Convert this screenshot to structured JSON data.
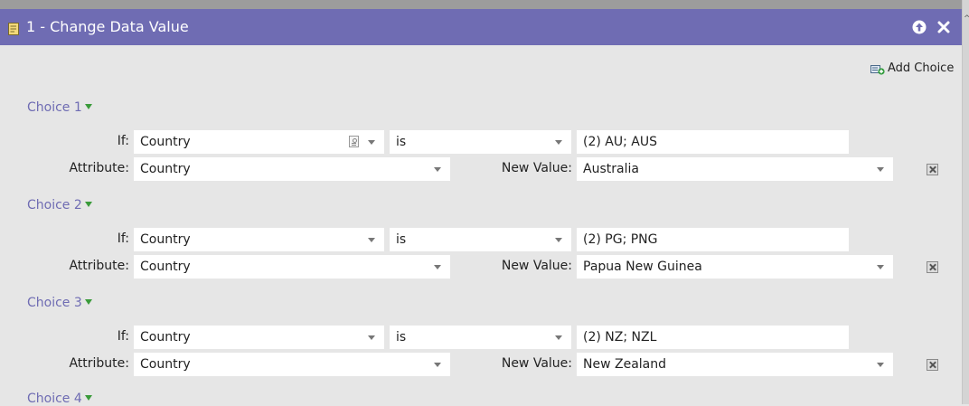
{
  "dialog": {
    "title": "1 - Change Data Value",
    "icon": "document-edit-icon",
    "controls": [
      "arrow-up-icon",
      "close-icon"
    ]
  },
  "toolbar": {
    "add_choice_label": "Add Choice",
    "add_choice_icon": "add-choice-icon"
  },
  "labels": {
    "if": "If:",
    "attribute": "Attribute:",
    "new_value": "New Value:"
  },
  "choices": [
    {
      "label": "Choice 1",
      "if_field": "Country",
      "operator": "is",
      "values": "(2) AU; AUS",
      "attribute": "Country",
      "new_value": "Australia"
    },
    {
      "label": "Choice 2",
      "if_field": "Country",
      "operator": "is",
      "values": "(2) PG; PNG",
      "attribute": "Country",
      "new_value": "Papua New Guinea"
    },
    {
      "label": "Choice 3",
      "if_field": "Country",
      "operator": "is",
      "values": "(2) NZ; NZL",
      "attribute": "Country",
      "new_value": "New Zealand"
    },
    {
      "label": "Choice 4"
    }
  ],
  "colors": {
    "title_bar": "#6f6cb3",
    "choice_heading": "#6f6cb3",
    "panel_bg": "#e6e6e6",
    "expand_arrow": "#3a9b3a"
  }
}
